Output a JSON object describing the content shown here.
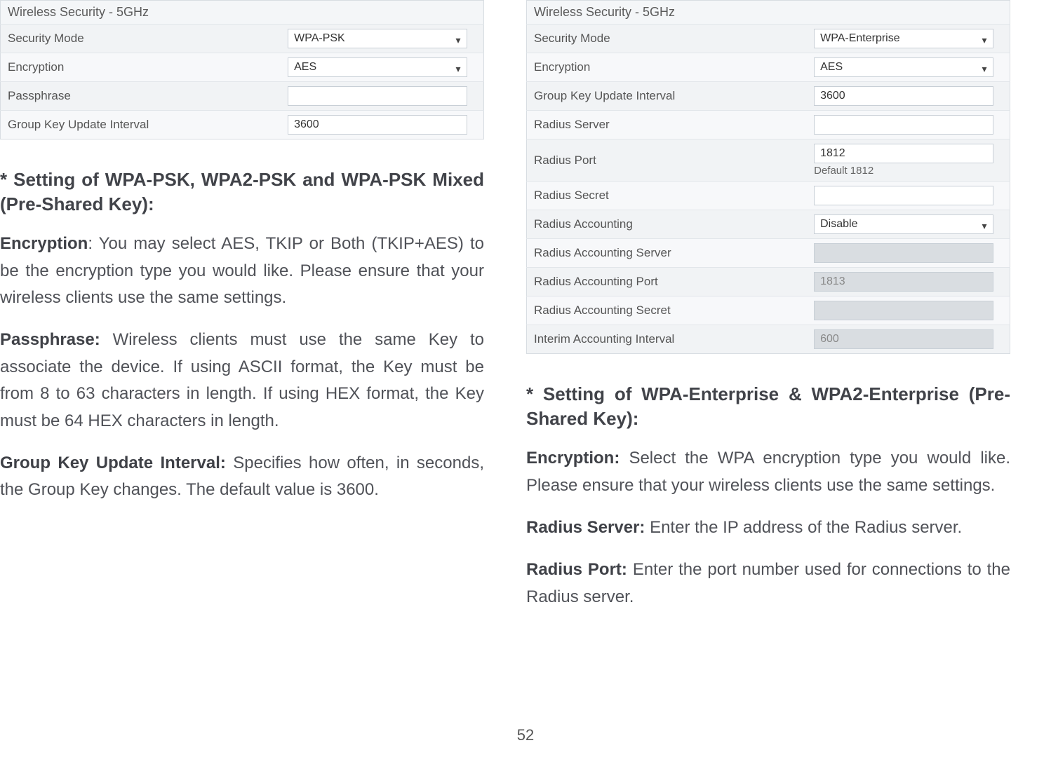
{
  "page_number": "52",
  "left": {
    "panel_title": "Wireless Security - 5GHz",
    "rows": {
      "security_mode_label": "Security Mode",
      "security_mode_value": "WPA-PSK",
      "encryption_label": "Encryption",
      "encryption_value": "AES",
      "passphrase_label": "Passphrase",
      "passphrase_value": "",
      "gkui_label": "Group Key Update Interval",
      "gkui_value": "3600"
    },
    "heading": "* Setting of WPA-PSK, WPA2-PSK and WPA-PSK Mixed (Pre-Shared Key):",
    "p1_bold": "Encryption",
    "p1_rest": ": You may select AES, TKIP or Both (TKIP+AES) to be the encryption type you would like. Please ensure that your wireless clients use the same settings.",
    "p2_bold": "Passphrase:",
    "p2_rest": " Wireless clients must use the same Key to associate the device. If using ASCII format, the Key must be from 8 to 63 characters in length. If using HEX format, the Key must be 64 HEX characters in length.",
    "p3_bold": "Group Key Update Interval:",
    "p3_rest": " Specifies how often, in seconds, the Group Key changes. The default value is 3600."
  },
  "right": {
    "panel_title": "Wireless Security - 5GHz",
    "rows": {
      "security_mode_label": "Security Mode",
      "security_mode_value": "WPA-Enterprise",
      "encryption_label": "Encryption",
      "encryption_value": "AES",
      "gkui_label": "Group Key Update Interval",
      "gkui_value": "3600",
      "radius_server_label": "Radius Server",
      "radius_server_value": "",
      "radius_port_label": "Radius Port",
      "radius_port_value": "1812",
      "radius_port_hint": "Default 1812",
      "radius_secret_label": "Radius Secret",
      "radius_secret_value": "",
      "radius_accounting_label": "Radius Accounting",
      "radius_accounting_value": "Disable",
      "ra_server_label": "Radius Accounting Server",
      "ra_server_value": "",
      "ra_port_label": "Radius Accounting Port",
      "ra_port_value": "1813",
      "ra_secret_label": "Radius Accounting Secret",
      "ra_secret_value": "",
      "interim_label": "Interim Accounting Interval",
      "interim_value": "600"
    },
    "heading": "* Setting of WPA-Enterprise & WPA2-Enterprise (Pre-Shared Key):",
    "p1_bold": "Encryption:",
    "p1_rest": " Select the WPA encryption type you would like. Please ensure that your wireless clients use the same settings.",
    "p2_bold": "Radius Server:",
    "p2_rest": " Enter the IP address of the Radius server.",
    "p3_bold": "Radius Port:",
    "p3_rest": " Enter the port number used for connections to the Radius server."
  }
}
